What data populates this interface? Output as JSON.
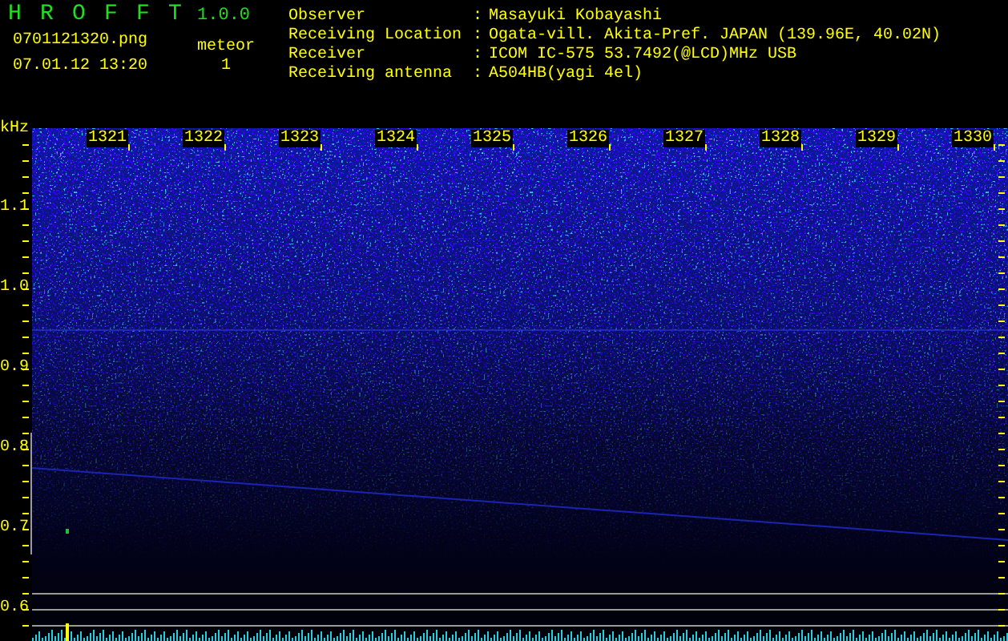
{
  "app": {
    "name": "H R O F F T",
    "version": "1.0.0"
  },
  "file_name": "0701121320.png",
  "datetime": "07.01.12 13:20",
  "meteor": {
    "label": "meteor",
    "count": "1"
  },
  "station": [
    {
      "label": "Observer",
      "separator": ":",
      "value": "Masayuki Kobayashi"
    },
    {
      "label": "Receiving Location",
      "separator": ":",
      "value": "Ogata-vill. Akita-Pref. JAPAN (139.96E, 40.02N)"
    },
    {
      "label": "Receiver",
      "separator": ":",
      "value": "ICOM IC-575 53.7492(@LCD)MHz USB"
    },
    {
      "label": "Receiving antenna",
      "separator": ":",
      "value": "A504HB(yagi 4el)"
    }
  ],
  "spectrogram": {
    "y_unit": "kHz",
    "y_labels": [
      "1.1",
      "1.0",
      "0.9",
      "0.8",
      "0.7",
      "0.6"
    ],
    "x_labels": [
      "1321",
      "1322",
      "1323",
      "1324",
      "1325",
      "1326",
      "1327",
      "1328",
      "1329",
      "1330"
    ]
  }
}
